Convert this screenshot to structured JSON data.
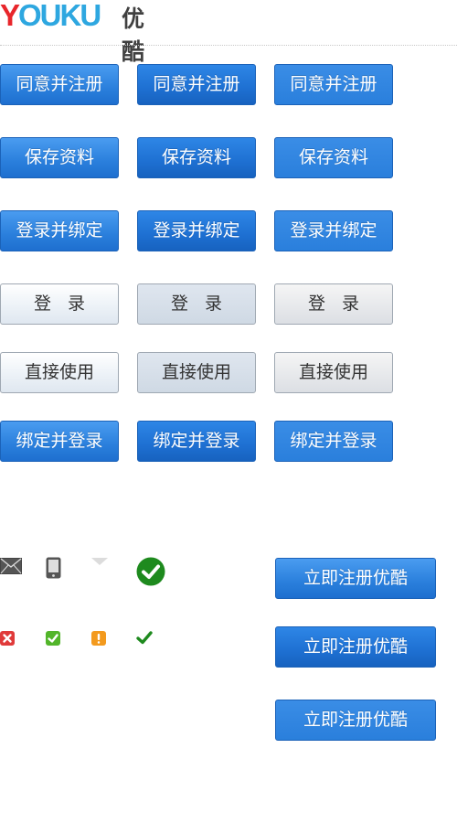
{
  "logo": {
    "brand_first": "Y",
    "brand_rest": "OUKU",
    "brand_cn": "优酷"
  },
  "rows": [
    {
      "style": "blue",
      "label": "同意并注册"
    },
    {
      "style": "blue",
      "label": "保存资料"
    },
    {
      "style": "blue",
      "label": "登录并绑定"
    },
    {
      "style": "gray",
      "label": "登录"
    },
    {
      "style": "gray",
      "label": "直接使用"
    },
    {
      "style": "blue",
      "label": "绑定并登录"
    }
  ],
  "register_buttons": [
    "立即注册优酷",
    "立即注册优酷",
    "立即注册优酷"
  ],
  "icons": {
    "row1": [
      "mail-icon",
      "mobile-phone-icon",
      "dropdown-arrow-icon",
      "check-circle-icon"
    ],
    "row2": [
      "error-x-icon",
      "success-check-icon",
      "warning-exclamation-icon",
      "checkmark-icon"
    ]
  },
  "colors": {
    "blue": "#2a7fdc",
    "green": "#1e8a1e",
    "red": "#e03a3a",
    "orange": "#f39a1e",
    "gray_icon": "#555555"
  }
}
